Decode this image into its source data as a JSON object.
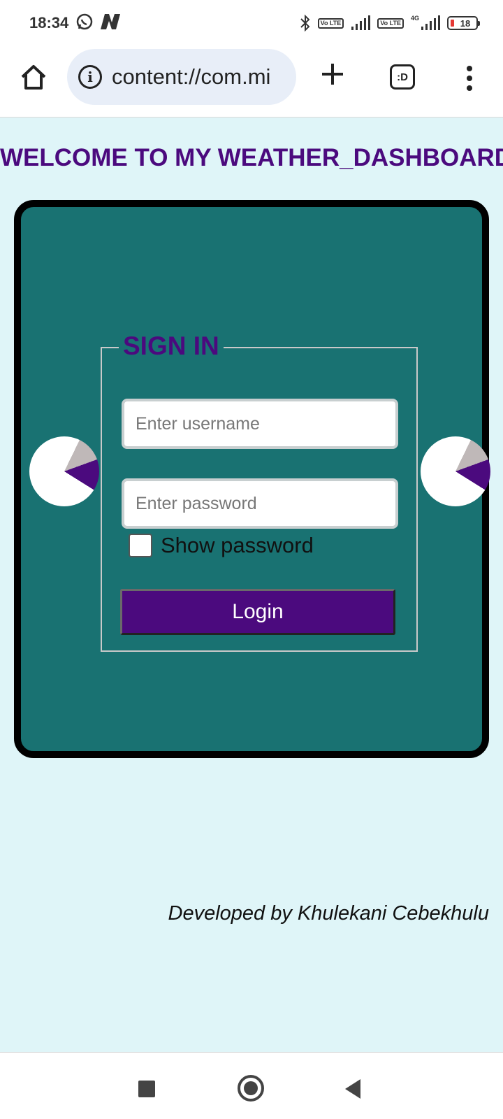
{
  "status_bar": {
    "time": "18:34",
    "battery": "18",
    "lte_badge_1": "Vo LTE",
    "lte_badge_2": "Vo LTE",
    "network_label": "4G"
  },
  "browser": {
    "url": "content://com.mi",
    "info_glyph": "i",
    "tabs_label": ":D"
  },
  "page": {
    "welcome": "WELCOME TO MY WEATHER_DASHBOARD",
    "sign_in": "SIGN IN",
    "username_placeholder": "Enter username",
    "password_placeholder": "Enter password",
    "show_password": "Show password",
    "login_button": "Login",
    "credit": "Developed by Khulekani Cebekhulu"
  },
  "colors": {
    "page_bg": "#dff5f8",
    "card_bg": "#197272",
    "accent": "#4b0a7e"
  }
}
